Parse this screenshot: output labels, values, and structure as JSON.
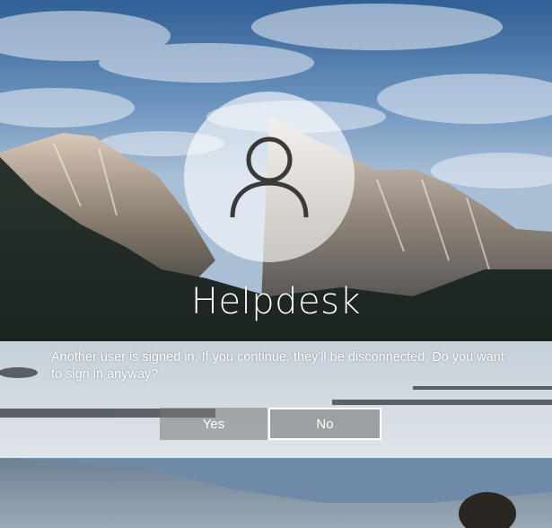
{
  "account": {
    "username": "Helpdesk",
    "avatar_icon": "user-icon"
  },
  "prompt": {
    "message": "Another user is signed in. If you continue, they'll be disconnected. Do you want to sign in anyway?"
  },
  "buttons": {
    "yes_label": "Yes",
    "no_label": "No"
  },
  "colors": {
    "text": "#ffffff",
    "button_bg": "#7a7a7a",
    "focus_border": "#ffffff"
  }
}
